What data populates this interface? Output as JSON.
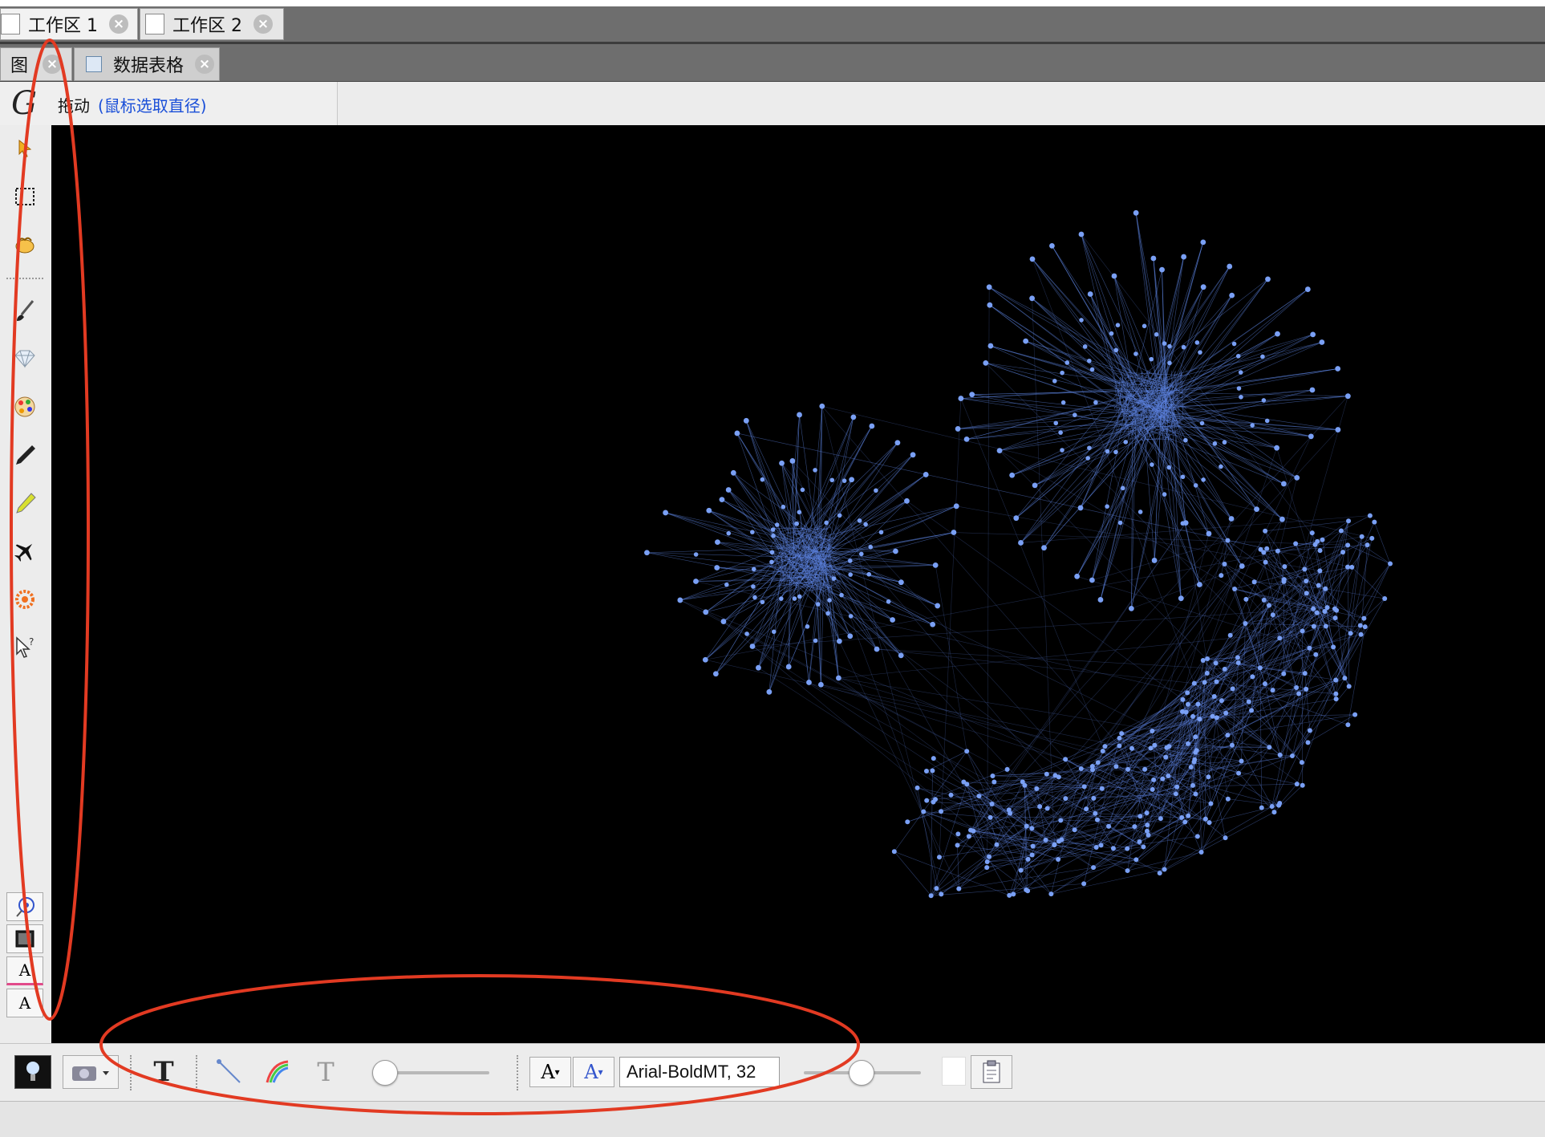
{
  "workspace_tabs": [
    {
      "label": "工作区 1",
      "active": true
    },
    {
      "label": "工作区 2",
      "active": false
    }
  ],
  "view_tabs": [
    {
      "label": "图",
      "active": true
    },
    {
      "label": "数据表格",
      "active": false
    }
  ],
  "toolbar": {
    "logo": "G",
    "drag_label": "拖动",
    "drag_hint": "(鼠标选取直径)"
  },
  "left_tools": [
    "pointer-icon",
    "rectangle-select-icon",
    "lasso-hand-icon",
    "paintbrush-icon",
    "diamond-icon",
    "color-palette-icon",
    "pencil-icon",
    "highlighter-icon",
    "airplane-icon",
    "sun-flower-icon",
    "pointer-question-icon"
  ],
  "left_bottom_buttons": [
    "center-graph-icon",
    "background-box-icon",
    "A",
    "A"
  ],
  "bottom_toolbar": {
    "font_value": "Arial-BoldMT, 32",
    "text_tool_glyph": "T",
    "text_tool_glyph_light": "T",
    "font_size_down_label": "A",
    "font_color_label": "A"
  },
  "colors": {
    "canvas_background": "#000000",
    "node_color": "#7aa0f5",
    "edge_color": "#5f86e6",
    "annotation_red": "#e23a22",
    "hint_blue": "#1a4fd8"
  }
}
